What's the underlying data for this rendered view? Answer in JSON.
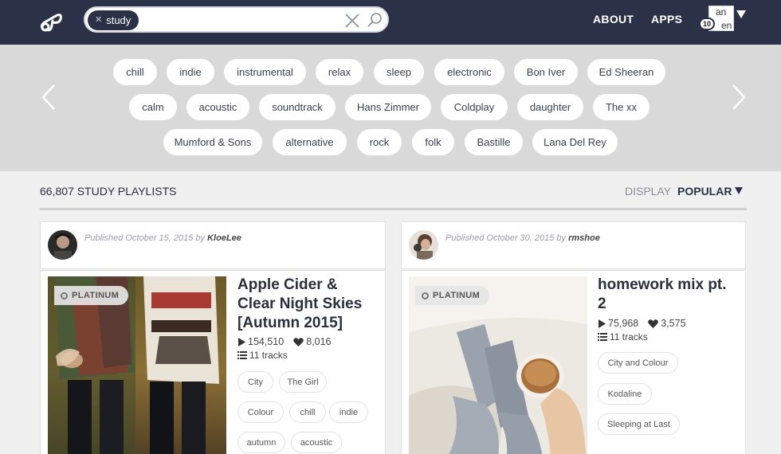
{
  "header": {
    "search_chip": "study",
    "search_placeholder": "",
    "nav": [
      "ABOUT",
      "APPS"
    ],
    "avatar_alt": [
      "an",
      "en"
    ],
    "notifications": "10"
  },
  "tags": [
    "chill",
    "indie",
    "instrumental",
    "relax",
    "sleep",
    "electronic",
    "Bon Iver",
    "Ed Sheeran",
    "calm",
    "acoustic",
    "soundtrack",
    "Hans Zimmer",
    "Coldplay",
    "daughter",
    "The xx",
    "Mumford & Sons",
    "alternative",
    "rock",
    "folk",
    "Bastille",
    "Lana Del Rey"
  ],
  "results": {
    "count_label": "66,807 STUDY PLAYLISTS",
    "display_label": "DISPLAY",
    "sort_label": "POPULAR"
  },
  "playlists": [
    {
      "published": "Published October 15, 2015 by",
      "author": "KloeLee",
      "badge": "PLATINUM",
      "title": [
        "Apple Cider &",
        "Clear Night Skies",
        "[Autumn 2015]"
      ],
      "plays": "154,510",
      "likes": "8,016",
      "tracks": "11 tracks",
      "tags": [
        "City",
        "The Girl",
        "Colour",
        "chill",
        "indie",
        "autumn",
        "acoustic"
      ]
    },
    {
      "published": "Published October 30, 2015 by",
      "author": "rmshoe",
      "badge": "PLATINUM",
      "title": [
        "homework mix pt.",
        "2"
      ],
      "plays": "75,968",
      "likes": "3,575",
      "tracks": "11 tracks",
      "tags": [
        "City and Colour",
        "Kodaline",
        "Sleeping at Last"
      ]
    }
  ]
}
